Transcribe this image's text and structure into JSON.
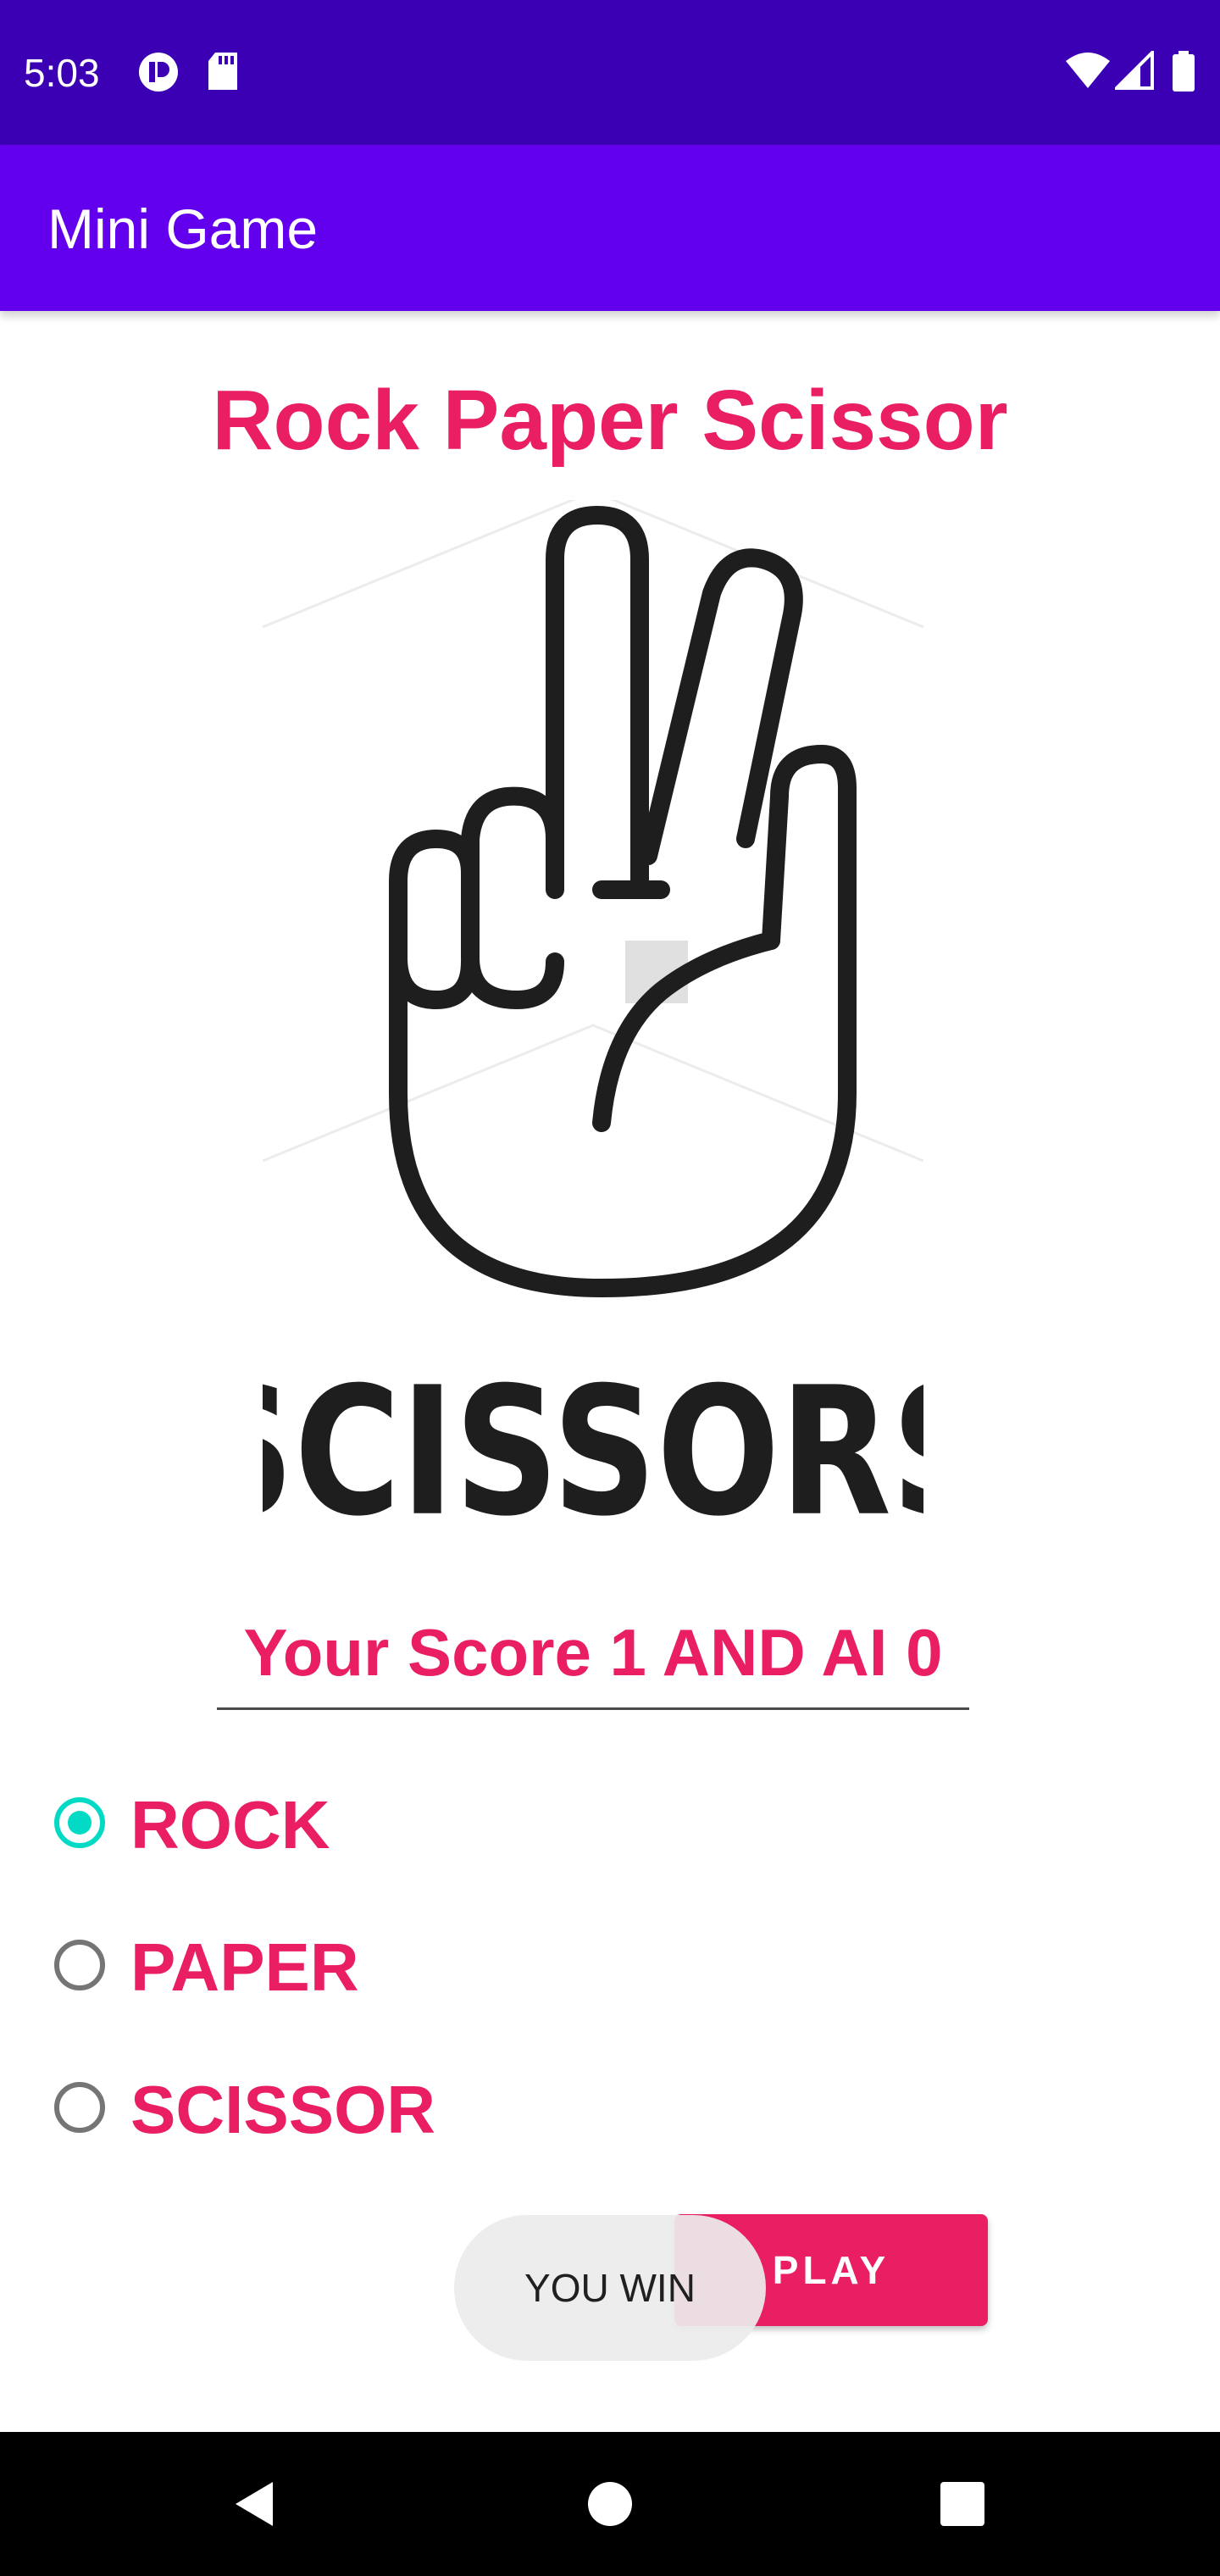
{
  "status_bar": {
    "time": "5:03",
    "icons": [
      "notification-app-icon",
      "sd-card-icon",
      "wifi-icon",
      "cellular-signal-icon",
      "battery-icon"
    ],
    "background": "#3b00b3"
  },
  "app_bar": {
    "title": "Mini Game",
    "background": "#6200ee"
  },
  "game": {
    "title": "Rock Paper Scissor",
    "image_caption": "SCISSORS",
    "score_text": "Your Score 1 AND AI 0",
    "options": [
      {
        "label": "ROCK",
        "checked": true
      },
      {
        "label": "PAPER",
        "checked": false
      },
      {
        "label": "SCISSOR",
        "checked": false
      }
    ],
    "play_label": "PLAY",
    "toast_text": "YOU WIN"
  },
  "colors": {
    "accent": "#e91e63",
    "radio_checked": "#03dac5"
  },
  "nav_bar": {
    "buttons": [
      "back-icon",
      "home-icon",
      "recents-icon"
    ]
  }
}
